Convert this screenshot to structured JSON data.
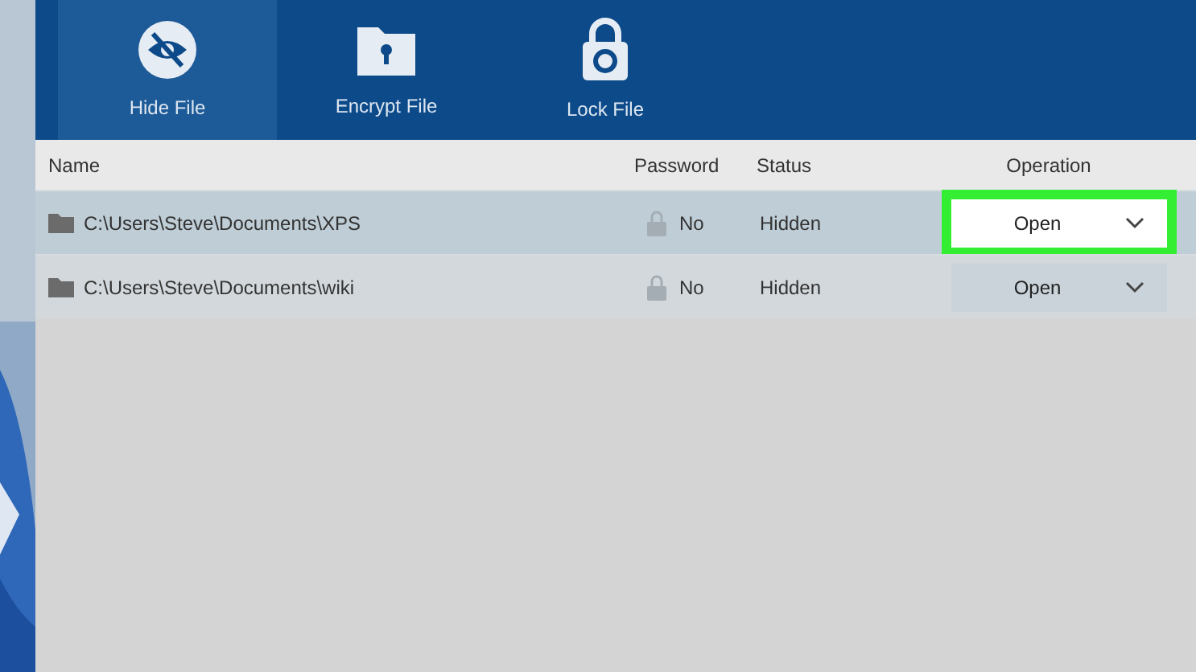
{
  "toolbar": {
    "tabs": [
      {
        "label": "Hide File",
        "selected": true
      },
      {
        "label": "Encrypt File",
        "selected": false
      },
      {
        "label": "Lock File",
        "selected": false
      }
    ]
  },
  "table": {
    "columns": [
      "Name",
      "Password",
      "Status",
      "Operation"
    ],
    "rows": [
      {
        "name": "C:\\Users\\Steve\\Documents\\XPS",
        "password": "No",
        "status": "Hidden",
        "action": "Open",
        "selected": true,
        "highlighted": true
      },
      {
        "name": "C:\\Users\\Steve\\Documents\\wiki",
        "password": "No",
        "status": "Hidden",
        "action": "Open",
        "selected": false,
        "highlighted": false
      }
    ]
  }
}
